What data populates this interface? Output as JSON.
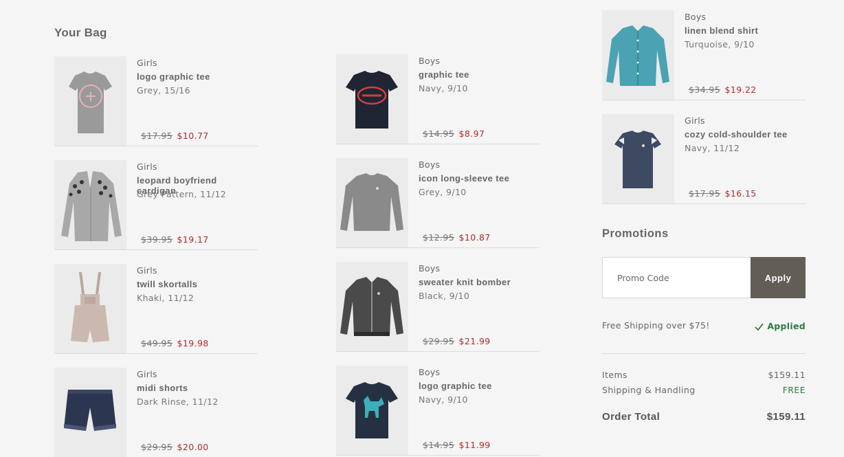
{
  "bag": {
    "title": "Your Bag",
    "items": [
      {
        "category": "Girls",
        "name": "logo graphic tee",
        "variant": "Grey, 15/16",
        "original_price": "$17.95",
        "sale_price": "$10.77",
        "icon": "grey-logo-tee-image"
      },
      {
        "category": "Girls",
        "name": "leopard boyfriend cardigan",
        "variant": "Grey Pattern, 11/12",
        "original_price": "$39.95",
        "sale_price": "$19.17",
        "icon": "grey-cardigan-image"
      },
      {
        "category": "Girls",
        "name": "twill skortalls",
        "variant": "Khaki, 11/12",
        "original_price": "$49.95",
        "sale_price": "$19.98",
        "icon": "khaki-skortalls-image"
      },
      {
        "category": "Girls",
        "name": "midi shorts",
        "variant": "Dark Rinse, 11/12",
        "original_price": "$29.95",
        "sale_price": "$20.00",
        "icon": "denim-shorts-image"
      },
      {
        "category": "Boys",
        "name": "graphic tee",
        "variant": "Navy, 9/10",
        "original_price": "$14.95",
        "sale_price": "$8.97",
        "icon": "navy-graphic-tee-image"
      },
      {
        "category": "Boys",
        "name": "icon long-sleeve tee",
        "variant": "Grey, 9/10",
        "original_price": "$12.95",
        "sale_price": "$10.87",
        "icon": "grey-long-sleeve-image"
      },
      {
        "category": "Boys",
        "name": "sweater knit bomber",
        "variant": "Black, 9/10",
        "original_price": "$29.95",
        "sale_price": "$21.99",
        "icon": "bomber-jacket-image"
      },
      {
        "category": "Boys",
        "name": "logo graphic tee",
        "variant": "Navy, 9/10",
        "original_price": "$14.95",
        "sale_price": "$11.99",
        "icon": "navy-moose-tee-image"
      },
      {
        "category": "Boys",
        "name": "linen blend shirt",
        "variant": "Turquoise, 9/10",
        "original_price": "$34.95",
        "sale_price": "$19.22",
        "icon": "turquoise-shirt-image"
      },
      {
        "category": "Girls",
        "name": "cozy cold-shoulder tee",
        "variant": "Navy, 11/12",
        "original_price": "$17.95",
        "sale_price": "$16.15",
        "icon": "navy-cold-shoulder-tee-image"
      }
    ]
  },
  "promotions": {
    "title": "Promotions",
    "placeholder": "Promo Code",
    "apply_label": "Apply",
    "shipping_text": "Free Shipping over $75!",
    "applied_label": "Applied",
    "applied_color": "#2e7a3e"
  },
  "summary": {
    "items_label": "Items",
    "items_value": "$159.11",
    "shipping_label": "Shipping & Handling",
    "shipping_value": "FREE",
    "total_label": "Order Total",
    "total_value": "$159.11"
  },
  "colors": {
    "sale_price": "#b32a2a",
    "apply_button": "#625d55",
    "background": "#f5f5f5"
  }
}
